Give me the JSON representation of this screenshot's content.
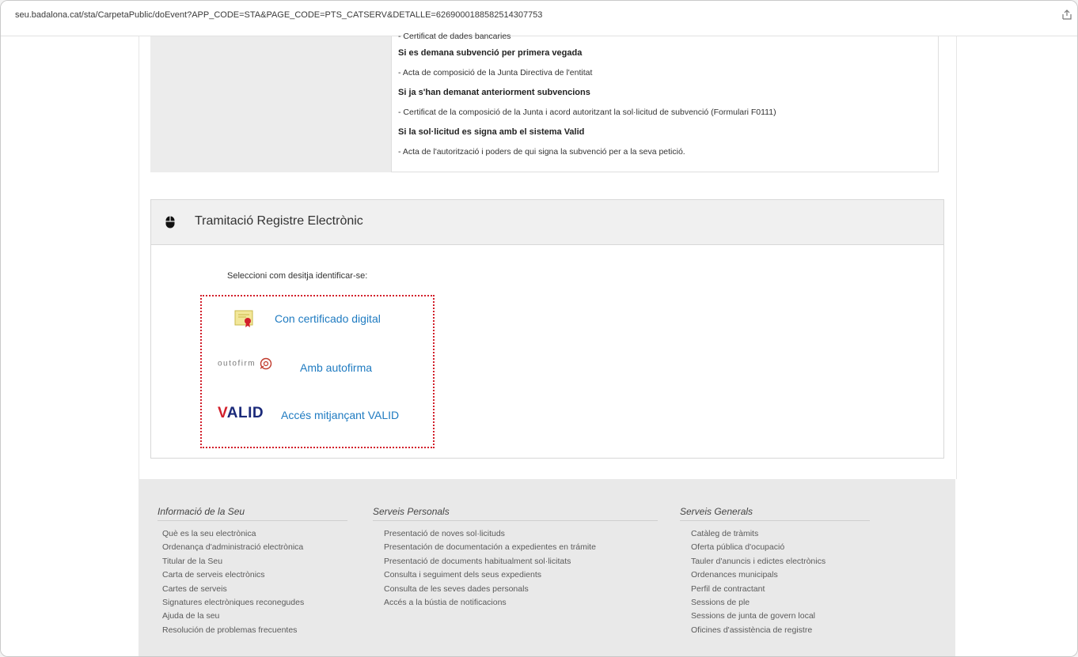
{
  "browser": {
    "url": "seu.badalona.cat/sta/CarpetaPublic/doEvent?APP_CODE=STA&PAGE_CODE=PTS_CATSERV&DETALLE=6269000188582514307753"
  },
  "requirements": {
    "lines": [
      {
        "text": "- Certificat de dades bancaries",
        "bold": false
      },
      {
        "text": "Si es demana subvenció per primera vegada",
        "bold": true
      },
      {
        "text": "- Acta de composició de la Junta Directiva de l'entitat",
        "bold": false
      },
      {
        "text": "Si ja s'han demanat anteriorment subvencions",
        "bold": true
      },
      {
        "text": "- Certificat de la composició de la Junta i acord autoritzant la sol·licitud de subvenció (Formulari F0111)",
        "bold": false
      },
      {
        "text": "Si la sol·licitud es signa amb el sistema Valid",
        "bold": true
      },
      {
        "text": "- Acta de l'autorització i poders de qui signa la subvenció per a la seva petició.",
        "bold": false
      }
    ]
  },
  "panel": {
    "title": "Tramitació Registre Electrònic",
    "select_label": "Seleccioni com desitja identificar-se:",
    "options": {
      "certificate": "Con certificado digital",
      "autofirma_logo": "outofirm",
      "autofirma": "Amb autofirma",
      "valid_logo_v": "V",
      "valid_logo_rest": "ALID",
      "valid": "Accés mitjançant VALID"
    }
  },
  "footer": {
    "columns": [
      {
        "heading": "Informació de la Seu",
        "items": [
          "Què es la seu electrònica",
          "Ordenança d'administració electrònica",
          "Titular de la Seu",
          "Carta de serveis electrònics",
          "Cartes de serveis",
          "Signatures electròniques reconegudes",
          "Ajuda de la seu",
          "Resolución de problemas frecuentes"
        ]
      },
      {
        "heading": "Serveis Personals",
        "items": [
          "Presentació de noves sol·licituds",
          "Presentación de documentación a expedientes en trámite",
          "Presentació de documents habitualment sol·licitats",
          "Consulta i seguiment dels seus expedients",
          "Consulta de les seves dades personals",
          "Accés a la bústia de notificacions"
        ]
      },
      {
        "heading": "Serveis Generals",
        "items": [
          "Catàleg de tràmits",
          "Oferta pública d'ocupació",
          "Tauler d'anuncis i edictes electrònics",
          "Ordenances municipals",
          "Perfil de contractant",
          "Sessions de ple",
          "Sessions de junta de govern local",
          "Oficines d'assistència de registre"
        ]
      }
    ]
  }
}
